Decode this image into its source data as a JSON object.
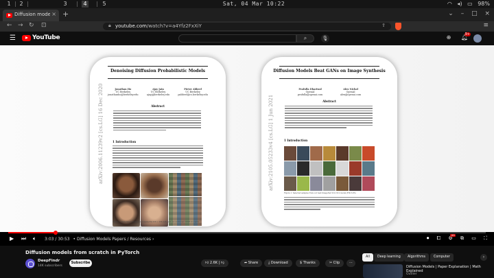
{
  "os_bar": {
    "workspaces": [
      "1",
      "2",
      "3",
      "4",
      "5"
    ],
    "active_workspace": "4",
    "clock": "Sat, 04 Mar  10:22",
    "battery": "98%"
  },
  "browser": {
    "tab_title": "Diffusion models from scra",
    "url_host": "youtube.com",
    "url_path": "/watch?v=a4Yfz2FxXiY"
  },
  "youtube": {
    "logo_text": "YouTube",
    "notifications_badge": "9+"
  },
  "video": {
    "current_time": "3:03",
    "duration": "30:53",
    "chapter": "Diffusion Models Papers / Resources",
    "progress_fraction": 0.099,
    "hd_badge": "HD"
  },
  "slide": {
    "left_paper": {
      "title": "Denoising Diffusion Probabilistic Models",
      "authors": [
        {
          "name": "Jonathan Ho",
          "affil": "UC Berkeley",
          "email": "jonathanho@berkeley.edu"
        },
        {
          "name": "Ajay Jain",
          "affil": "UC Berkeley",
          "email": "ajayj@berkeley.edu"
        },
        {
          "name": "Pieter Abbeel",
          "affil": "UC Berkeley",
          "email": "pabbeel@cs.berkeley.edu"
        }
      ],
      "abstract_heading": "Abstract",
      "section_heading": "1   Introduction",
      "arxiv_id": "arXiv:2006.11239v2  [cs.LG]  16 Dec 2020",
      "caption": "Figure 1: Generated samples on CelebA-HQ 256 × 256 (left) and unconditional CIFAR10 (right)"
    },
    "right_paper": {
      "title": "Diffusion Models Beat GANs on Image Synthesis",
      "authors": [
        {
          "name": "Prafulla Dhariwal",
          "affil": "OpenAI",
          "email": "prafulla@openai.com"
        },
        {
          "name": "Alex Nichol",
          "affil": "OpenAI",
          "email": "alex@openai.com"
        }
      ],
      "abstract_heading": "Abstract",
      "section_heading": "1   Introduction",
      "arxiv_id": "arXiv:2105.05233v4  [cs.LG]  1 Jun 2021",
      "caption": "Figure 1: Selected samples from our best ImageNet 512×512 model (FID 3.85)"
    }
  },
  "below": {
    "title": "Diffusion models from scratch in PyTorch",
    "channel_name": "DeepFindr",
    "subscribers": "14K subscribers",
    "subscribe_label": "Subscribe",
    "likes": "2.6K",
    "share_label": "Share",
    "download_label": "Download",
    "thanks_label": "Thanks",
    "clip_label": "Clip",
    "more_label": "···",
    "chips": [
      "All",
      "Deep learning",
      "Algorithms",
      "Computer"
    ],
    "recommended_title": "Diffusion Models | Paper Explanation | Math Explained",
    "recommended_sub": "Outlier"
  }
}
